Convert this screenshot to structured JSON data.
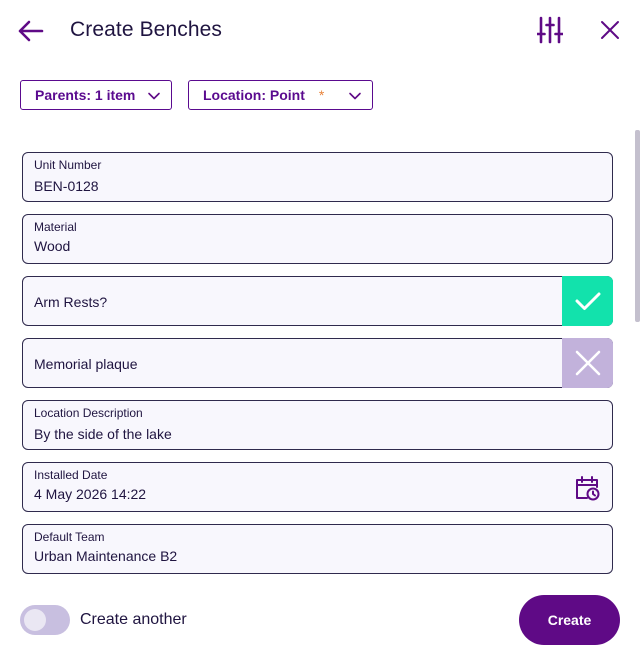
{
  "header": {
    "title": "Create Benches",
    "back_icon": "arrow-left-icon",
    "filter_icon": "sliders-icon",
    "close_icon": "close-icon"
  },
  "chips": {
    "parents_label": "Parents: 1 item",
    "location_label": "Location: Point",
    "location_required_marker": "*"
  },
  "form": {
    "unit_number": {
      "label": "Unit Number",
      "value": "BEN-0128"
    },
    "material": {
      "label": "Material",
      "value": "Wood"
    },
    "arm_rests": {
      "label": "Arm Rests?",
      "state": "yes"
    },
    "memorial_plaque": {
      "label": "Memorial plaque",
      "state": "no"
    },
    "location_description": {
      "label": "Location Description",
      "value": "By the side of the lake"
    },
    "installed_date": {
      "label": "Installed Date",
      "value": "4 May 2026 14:22"
    },
    "default_team": {
      "label": "Default Team",
      "value": "Urban Maintenance B2"
    }
  },
  "footer": {
    "create_another_label": "Create another",
    "create_another_on": false,
    "create_button_label": "Create"
  },
  "colors": {
    "primary": "#5f0a86",
    "text": "#1f1440",
    "toggle_yes": "#12e2ac",
    "toggle_no": "#c2b2db",
    "required": "#e8833a"
  }
}
